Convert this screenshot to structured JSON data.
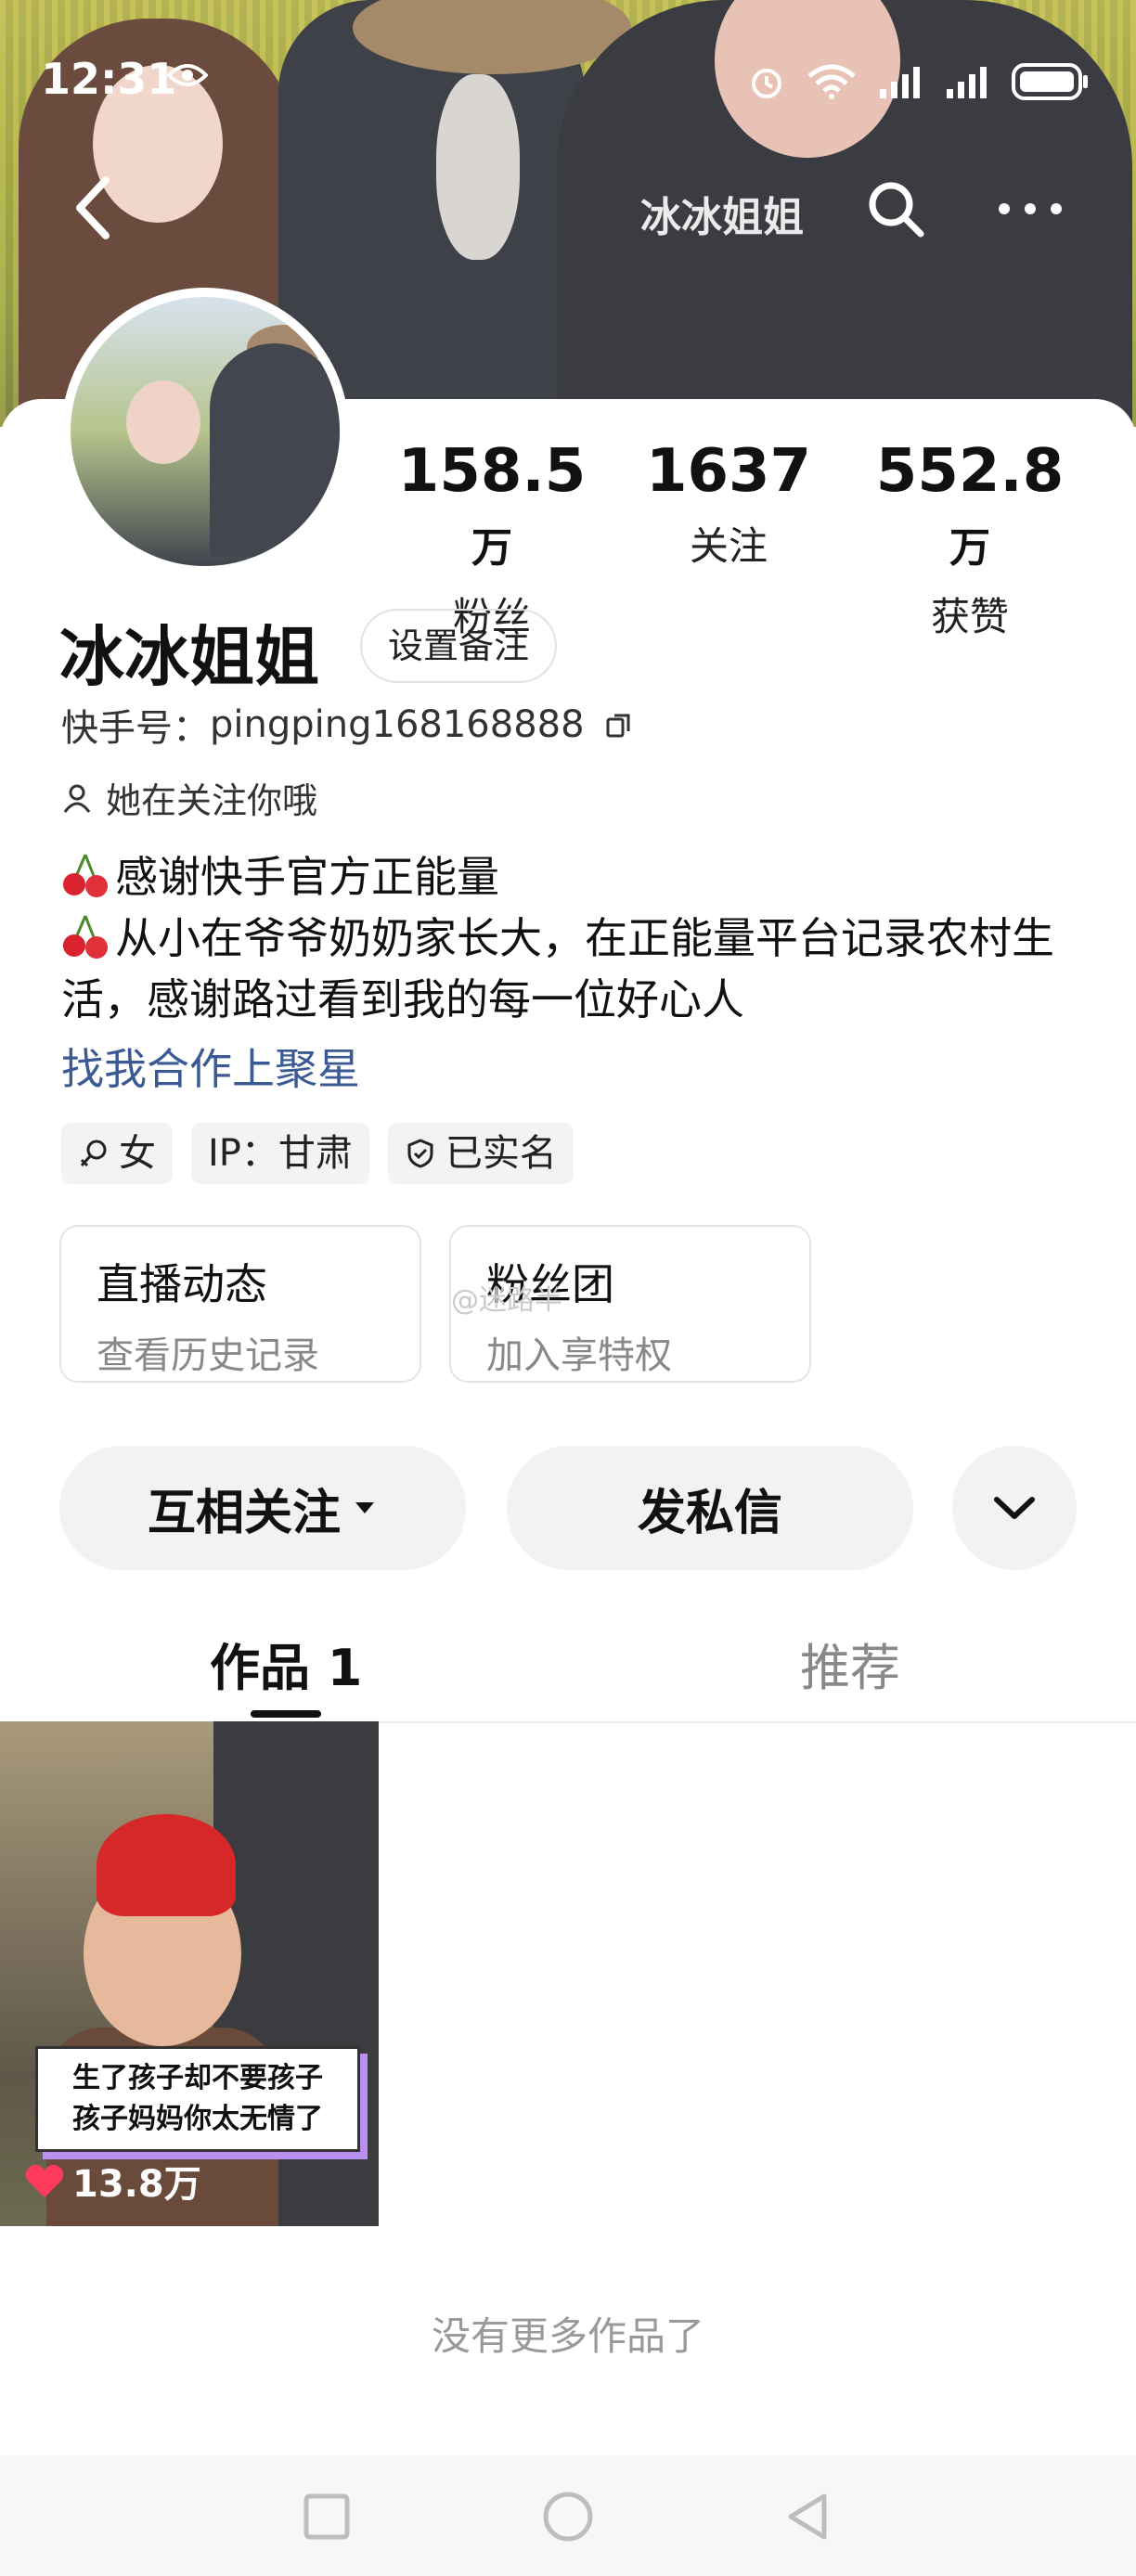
{
  "status_bar": {
    "time": "12:31"
  },
  "top_nav": {
    "title": "冰冰姐姐"
  },
  "profile": {
    "name": "冰冰姐姐",
    "remark_button": "设置备注",
    "kuaishou_id_label": "快手号：",
    "kuaishou_id": "pingping168168888",
    "follows_you": "她在关注你哦",
    "bio_lines": [
      "感谢快手官方正能量",
      "从小在爷爷奶奶家长大，在正能量平台记录农村生活，感谢路过看到我的每一位好心人"
    ],
    "bio_link": "找我合作上聚星"
  },
  "stats": [
    {
      "value": "158.5",
      "unit": "万",
      "label": "粉丝"
    },
    {
      "value": "1637",
      "unit": "",
      "label": "关注"
    },
    {
      "value": "552.8",
      "unit": "万",
      "label": "获赞"
    }
  ],
  "tags": {
    "gender": "女",
    "ip": "IP：甘肃",
    "verified": "已实名"
  },
  "boxes": [
    {
      "title": "直播动态",
      "subtitle": "查看历史记录"
    },
    {
      "title": "粉丝团",
      "subtitle": "加入享特权",
      "watermark": "@迷路半"
    }
  ],
  "actions": {
    "mutual": "互相关注",
    "message": "发私信"
  },
  "tabs": [
    {
      "label": "作品 1"
    },
    {
      "label": "推荐"
    }
  ],
  "works": [
    {
      "caption_line1": "生了孩子却不要孩子",
      "caption_line2": "孩子妈妈你太无情了",
      "likes": "13.8万"
    }
  ],
  "footer_text": "没有更多作品了",
  "colors": {
    "link": "#3b5a94",
    "like_red": "#ff3b5c"
  }
}
